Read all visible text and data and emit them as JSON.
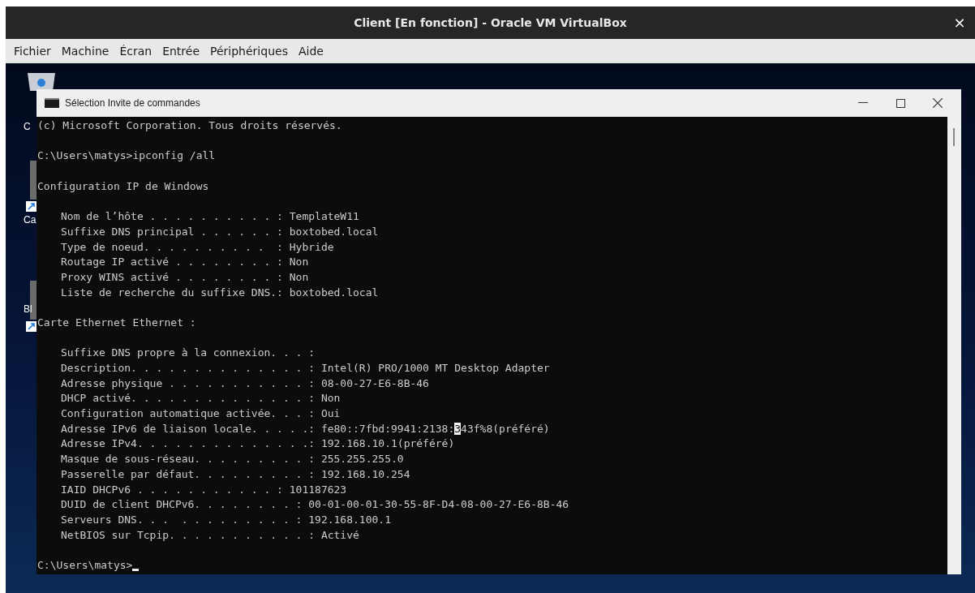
{
  "window": {
    "title": "Client [En fonction] - Oracle VM VirtualBox",
    "close_symbol": "×"
  },
  "menu": [
    "Fichier",
    "Machine",
    "Écran",
    "Entrée",
    "Périphériques",
    "Aide"
  ],
  "desktop": {
    "icons": [
      {
        "kind": "bin",
        "label": "C"
      },
      {
        "kind": "shortcut",
        "label": "Ca"
      },
      {
        "kind": "shortcut",
        "label": "Bl"
      }
    ]
  },
  "console_window": {
    "title": "Sélection Invite de commandes",
    "lines": [
      {
        "kind": "text",
        "indent": false,
        "text": "(c) Microsoft Corporation. Tous droits réservés."
      },
      {
        "kind": "blank"
      },
      {
        "kind": "text",
        "indent": false,
        "text": "C:\\Users\\matys>ipconfig /all"
      },
      {
        "kind": "blank"
      },
      {
        "kind": "text",
        "indent": false,
        "text": "Configuration IP de Windows"
      },
      {
        "kind": "blank"
      },
      {
        "kind": "text",
        "indent": true,
        "text": "Nom de l’hôte . . . . . . . . . . : TemplateW11"
      },
      {
        "kind": "text",
        "indent": true,
        "text": "Suffixe DNS principal . . . . . . : boxtobed.local"
      },
      {
        "kind": "text",
        "indent": true,
        "text": "Type de noeud. . . . . . . . . .  : Hybride"
      },
      {
        "kind": "text",
        "indent": true,
        "text": "Routage IP activé . . . . . . . . : Non"
      },
      {
        "kind": "text",
        "indent": true,
        "text": "Proxy WINS activé . . . . . . . . : Non"
      },
      {
        "kind": "text",
        "indent": true,
        "text": "Liste de recherche du suffixe DNS.: boxtobed.local"
      },
      {
        "kind": "blank"
      },
      {
        "kind": "text",
        "indent": false,
        "text": "Carte Ethernet Ethernet :"
      },
      {
        "kind": "blank"
      },
      {
        "kind": "text",
        "indent": true,
        "text": "Suffixe DNS propre à la connexion. . . :"
      },
      {
        "kind": "text",
        "indent": true,
        "text": "Description. . . . . . . . . . . . . . : Intel(R) PRO/1000 MT Desktop Adapter"
      },
      {
        "kind": "text",
        "indent": true,
        "text": "Adresse physique . . . . . . . . . . . : 08-00-27-E6-8B-46"
      },
      {
        "kind": "text",
        "indent": true,
        "text": "DHCP activé. . . . . . . . . . . . . . : Non"
      },
      {
        "kind": "text",
        "indent": true,
        "text": "Configuration automatique activée. . . : Oui"
      },
      {
        "kind": "selection",
        "indent": true,
        "before": "Adresse IPv6 de liaison locale. . . . .: fe80::7fbd:9941:2138:",
        "selected": "3",
        "after": "43f%8(préféré)"
      },
      {
        "kind": "text",
        "indent": true,
        "text": "Adresse IPv4. . . . . . . . . . . . . .: 192.168.10.1(préféré)"
      },
      {
        "kind": "text",
        "indent": true,
        "text": "Masque de sous-réseau. . . . . . . . . : 255.255.255.0"
      },
      {
        "kind": "text",
        "indent": true,
        "text": "Passerelle par défaut. . . . . . . . . : 192.168.10.254"
      },
      {
        "kind": "text",
        "indent": true,
        "text": "IAID DHCPv6 . . . . . . . . . . . : 101187623"
      },
      {
        "kind": "text",
        "indent": true,
        "text": "DUID de client DHCPv6. . . . . . . . : 00-01-00-01-30-55-8F-D4-08-00-27-E6-8B-46"
      },
      {
        "kind": "text",
        "indent": true,
        "text": "Serveurs DNS. . .  . . . . . . . . . : 192.168.100.1"
      },
      {
        "kind": "text",
        "indent": true,
        "text": "NetBIOS sur Tcpip. . . . . . . . . . . : Activé"
      },
      {
        "kind": "blank"
      },
      {
        "kind": "prompt",
        "indent": false,
        "text": "C:\\Users\\matys>",
        "cursor": true
      }
    ]
  }
}
